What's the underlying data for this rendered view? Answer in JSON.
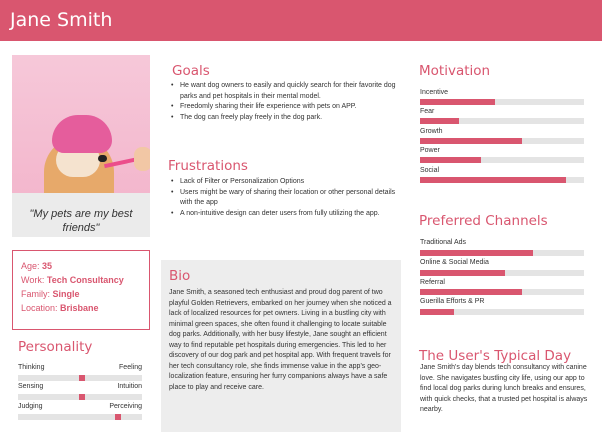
{
  "persona": {
    "name": "Jane Smith"
  },
  "quote": "\"My pets are my best friends\"",
  "info": [
    {
      "key": "Age:",
      "value": "35"
    },
    {
      "key": "Work:",
      "value": "Tech Consultancy"
    },
    {
      "key": "Family:",
      "value": "Single"
    },
    {
      "key": "Location:",
      "value": "Brisbane"
    }
  ],
  "goals": {
    "title": "Goals",
    "items": [
      "He want dog owners to easily and quickly search for their favorite dog parks and pet hospitals in their mental model.",
      "Freedomly sharing their life experience with pets on APP.",
      "The dog can freely play freely in the dog park."
    ]
  },
  "frustrations": {
    "title": "Frustrations",
    "items": [
      "Lack of Filter or Personalization Options",
      "Users might be wary of sharing their location or other personal details with the app",
      "A non-intuitive design can deter users from fully utilizing the app."
    ]
  },
  "bio": {
    "title": "Bio",
    "text": "Jane Smith, a seasoned tech enthusiast and proud dog parent of two playful Golden Retrievers, embarked on her journey when she noticed a lack of localized resources for pet owners. Living in a bustling city with minimal green spaces, she often found it challenging to locate suitable dog parks. Additionally, with her busy lifestyle, Jane sought an efficient way to find reputable pet hospitals during emergencies. This led to her discovery of our dog park and pet hospital app. With frequent travels for her tech consultancy role, she finds immense value in the app's geo-localization feature, ensuring her furry companions always have a safe place to play and receive care."
  },
  "personality": {
    "title": "Personality",
    "rows": [
      {
        "left": "Thinking",
        "right": "Feeling",
        "level": 0.52
      },
      {
        "left": "Sensing",
        "right": "Intuition",
        "level": 0.52
      },
      {
        "left": "Judging",
        "right": "Perceiving",
        "level": 0.81
      }
    ]
  },
  "motivation": {
    "title": "Motivation",
    "items": [
      {
        "label": "Incentive",
        "value": 0.46
      },
      {
        "label": "Fear",
        "value": 0.24
      },
      {
        "label": "Growth",
        "value": 0.62
      },
      {
        "label": "Power",
        "value": 0.37
      },
      {
        "label": "Social",
        "value": 0.89
      }
    ]
  },
  "channels": {
    "title": "Preferred Channels",
    "items": [
      {
        "label": "Traditional Ads",
        "value": 0.69
      },
      {
        "label": "Online & Social Media",
        "value": 0.52
      },
      {
        "label": "Referral",
        "value": 0.62
      },
      {
        "label": "Guerilla Efforts & PR",
        "value": 0.21
      }
    ]
  },
  "typical_day": {
    "title": "The User's Typical Day",
    "text": "Jane Smith's day blends tech consultancy with canine love. She navigates bustling city life, using our app to find local dog parks during lunch breaks and ensures, with quick checks, that a trusted pet hospital is always nearby."
  },
  "theme": {
    "accent": "#d9566f",
    "panel": "#ededed",
    "track": "#e4e4e4"
  }
}
